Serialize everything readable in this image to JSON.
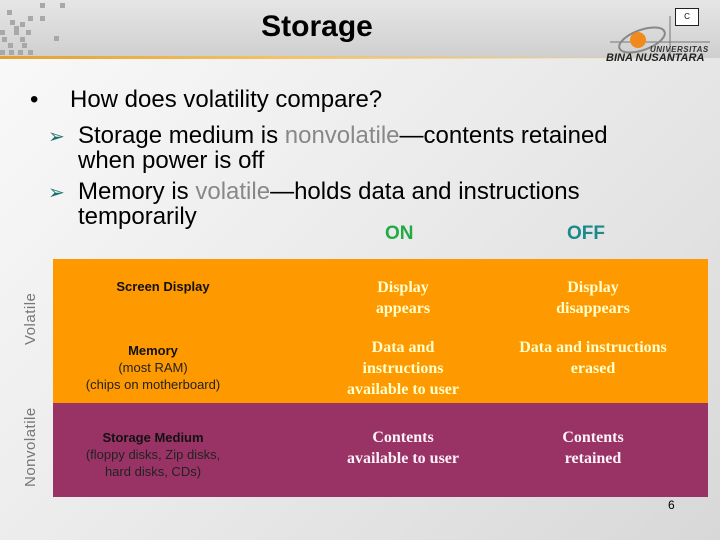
{
  "header": {
    "title": "Storage",
    "logo": {
      "line1": "UNIVERSITAS",
      "line2": "BINA NUSANTARA",
      "badge": "C"
    }
  },
  "content": {
    "question": "How does volatility compare?",
    "bullet_glyph": "•",
    "sub_glyph": "➢",
    "sub_bullets": [
      {
        "before": "Storage medium is ",
        "highlight": "nonvolatile",
        "after": "—contents retained",
        "line2": "when power is off"
      },
      {
        "before": "Memory is ",
        "highlight": "volatile",
        "after": "—holds data and instructions",
        "line2": "temporarily"
      }
    ]
  },
  "table": {
    "columns": [
      "ON",
      "OFF"
    ],
    "side_labels": {
      "volatile": "Volatile",
      "nonvolatile": "Nonvolatile"
    },
    "rows": [
      {
        "label": "Screen Display",
        "sub": [],
        "on": [
          "Display",
          "appears"
        ],
        "off": [
          "Display",
          "disappears"
        ]
      },
      {
        "label": "Memory",
        "sub": [
          "(most RAM)",
          "(chips on motherboard)"
        ],
        "on": [
          "Data and",
          "instructions",
          "available to user"
        ],
        "off": [
          "Data and instructions",
          "erased"
        ]
      },
      {
        "label": "Storage Medium",
        "sub": [
          "(floppy disks, Zip disks,",
          "hard disks, CDs)"
        ],
        "on": [
          "Contents",
          "available to user"
        ],
        "off": [
          "Contents",
          "retained"
        ]
      }
    ],
    "colors": {
      "volatile_bg": "#ff9900",
      "nonvolatile_bg": "#993366",
      "value_text": "#ffffcc",
      "on": "#22aa44",
      "off": "#1a8a8a"
    }
  },
  "footer": {
    "page_number": "6"
  }
}
